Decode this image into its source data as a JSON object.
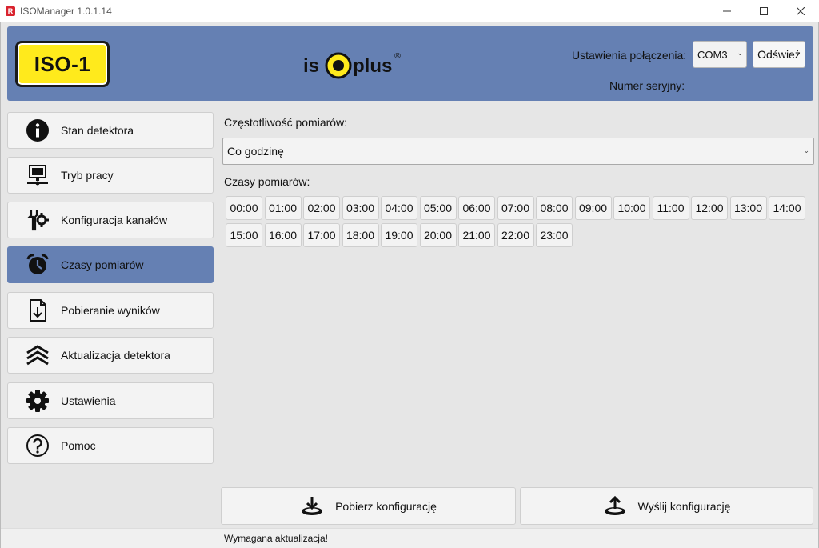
{
  "window": {
    "app_icon_letter": "R",
    "title": "ISOManager 1.0.1.14"
  },
  "header": {
    "badge": "ISO-1",
    "logo_left": "is",
    "logo_right": "plus",
    "logo_reg": "®",
    "connection_label": "Ustawienia połączenia:",
    "com_value": "COM3",
    "refresh_label": "Odśwież",
    "serial_label": "Numer seryjny:"
  },
  "sidebar": {
    "items": [
      {
        "label": "Stan detektora",
        "icon": "info-icon"
      },
      {
        "label": "Tryb pracy",
        "icon": "computer-icon"
      },
      {
        "label": "Konfiguracja kanałów",
        "icon": "tools-icon"
      },
      {
        "label": "Czasy pomiarów",
        "icon": "alarm-clock-icon"
      },
      {
        "label": "Pobieranie wyników",
        "icon": "download-file-icon"
      },
      {
        "label": "Aktualizacja detektora",
        "icon": "chevrons-up-icon"
      },
      {
        "label": "Ustawienia",
        "icon": "gear-icon"
      },
      {
        "label": "Pomoc",
        "icon": "help-icon"
      }
    ],
    "active_index": 3
  },
  "main": {
    "frequency_label": "Częstotliwość pomiarów:",
    "frequency_value": "Co godzinę",
    "times_label": "Czasy pomiarów:",
    "times": [
      "00:00",
      "01:00",
      "02:00",
      "03:00",
      "04:00",
      "05:00",
      "06:00",
      "07:00",
      "08:00",
      "09:00",
      "10:00",
      "11:00",
      "12:00",
      "13:00",
      "14:00",
      "15:00",
      "16:00",
      "17:00",
      "18:00",
      "19:00",
      "20:00",
      "21:00",
      "22:00",
      "23:00"
    ]
  },
  "actions": {
    "download_label": "Pobierz konfigurację",
    "upload_label": "Wyślij konfigurację"
  },
  "status": {
    "text": "Wymagana aktualizacja!"
  },
  "colors": {
    "accent": "#6580b3",
    "badge_yellow": "#ffea1c"
  }
}
